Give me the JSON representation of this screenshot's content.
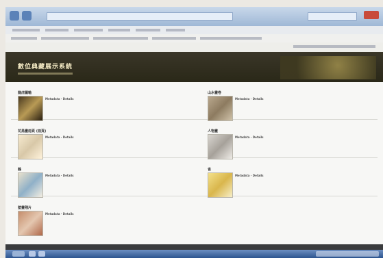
{
  "app": {
    "title": "數位典藏展示系統"
  },
  "items": [
    {
      "title": "龍虎圖軸",
      "meta": "Metadata · Details"
    },
    {
      "title": "山水畫卷",
      "meta": "Metadata · Details"
    },
    {
      "title": "花鳥畫冊頁 (冊頁)",
      "meta": "Metadata · Details"
    },
    {
      "title": "人物畫",
      "meta": "Metadata · Details"
    },
    {
      "title": "鶴",
      "meta": "Metadata · Details"
    },
    {
      "title": "雀",
      "meta": "Metadata · Details"
    },
    {
      "title": "壁畫殘片",
      "meta": "Metadata · Details"
    }
  ],
  "colors": {
    "banner": "#2f2c1c",
    "banner_text": "#f6ecc6",
    "background": "#f7f7f5"
  }
}
